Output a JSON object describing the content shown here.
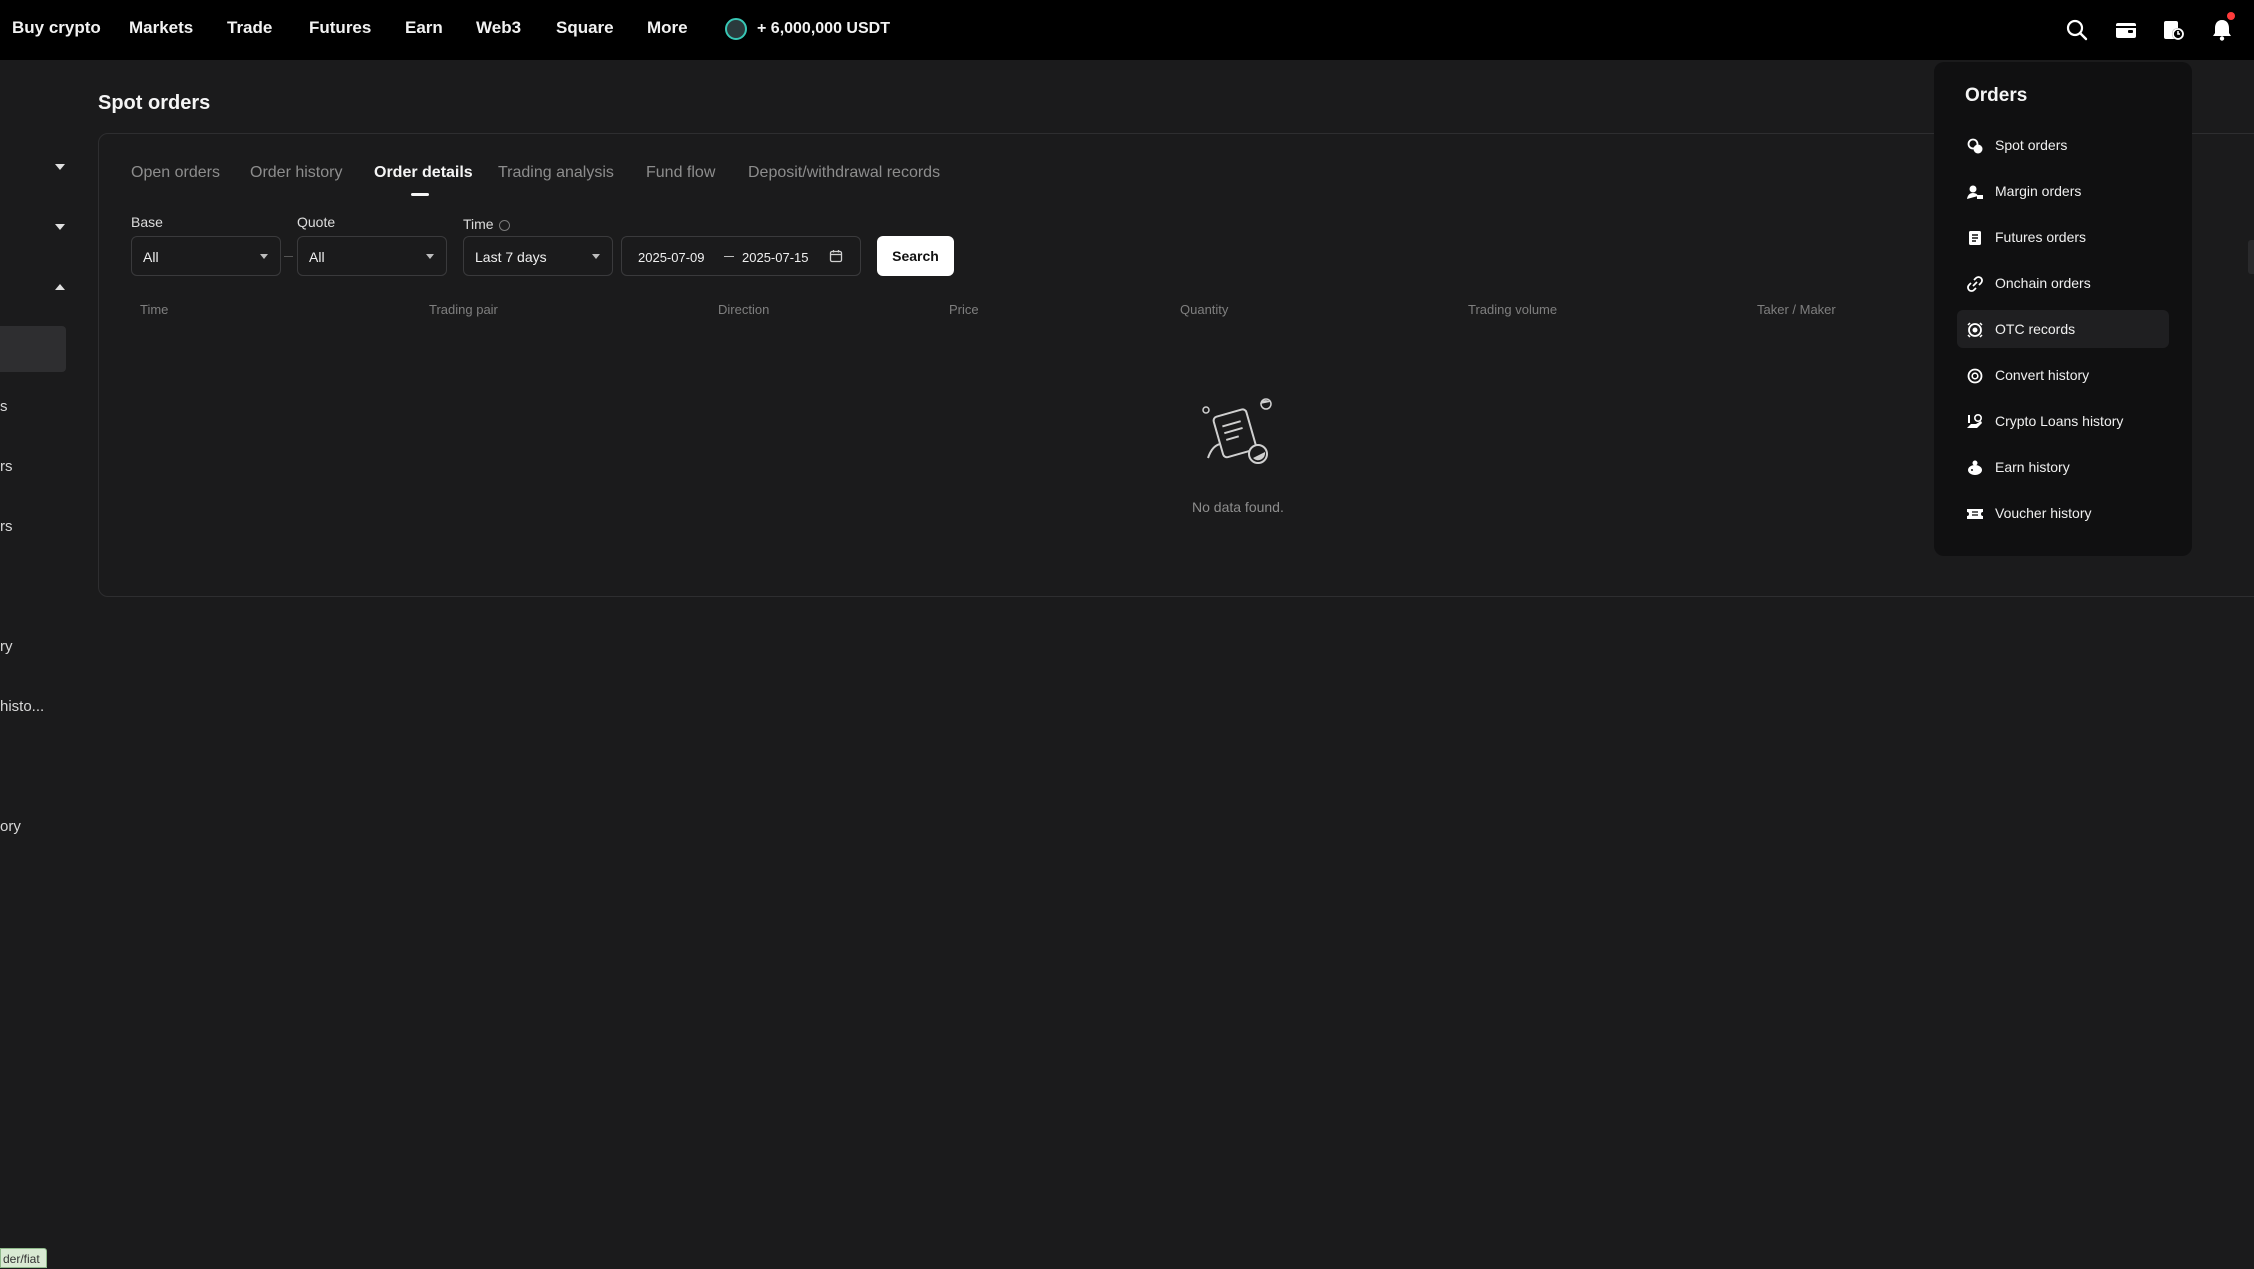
{
  "nav": {
    "items": [
      "Buy crypto",
      "Markets",
      "Trade",
      "Futures",
      "Earn",
      "Web3",
      "Square",
      "More"
    ],
    "promo": "+ 6,000,000 USDT",
    "icons": [
      "search-icon",
      "wallet-icon",
      "orders-history-icon",
      "bell-icon"
    ]
  },
  "sidebar": {
    "fragments": [
      "s",
      "rs",
      "rs",
      "ry",
      "histo...",
      "ory"
    ]
  },
  "page": {
    "title": "Spot orders"
  },
  "tabs": [
    "Open orders",
    "Order history",
    "Order details",
    "Trading analysis",
    "Fund flow",
    "Deposit/withdrawal records"
  ],
  "active_tab": "Order details",
  "filters": {
    "base_label": "Base",
    "base_value": "All",
    "quote_label": "Quote",
    "quote_value": "All",
    "time_label": "Time",
    "time_value": "Last 7 days",
    "date_start": "2025-07-09",
    "date_end": "2025-07-15",
    "search_label": "Search"
  },
  "table": {
    "columns": [
      "Time",
      "Trading pair",
      "Direction",
      "Price",
      "Quantity",
      "Trading volume",
      "Taker / Maker"
    ],
    "empty_text": "No data found."
  },
  "orders_menu": {
    "title": "Orders",
    "items": [
      {
        "label": "Spot orders",
        "icon": "spot-orders-icon"
      },
      {
        "label": "Margin orders",
        "icon": "margin-orders-icon"
      },
      {
        "label": "Futures orders",
        "icon": "futures-orders-icon"
      },
      {
        "label": "Onchain orders",
        "icon": "onchain-orders-icon"
      },
      {
        "label": "OTC records",
        "icon": "otc-records-icon"
      },
      {
        "label": "Convert history",
        "icon": "convert-history-icon"
      },
      {
        "label": "Crypto Loans history",
        "icon": "crypto-loans-icon"
      },
      {
        "label": "Earn history",
        "icon": "earn-history-icon"
      },
      {
        "label": "Voucher history",
        "icon": "voucher-history-icon"
      }
    ],
    "hovered": "OTC records"
  },
  "status_bar": {
    "url": "der/fiat"
  },
  "colors": {
    "background": "#1b1b1c",
    "nav_background": "#000000",
    "dropdown_background": "#101011",
    "notification_dot": "#ff3b3b",
    "promo_accent": "#38c7b5"
  }
}
